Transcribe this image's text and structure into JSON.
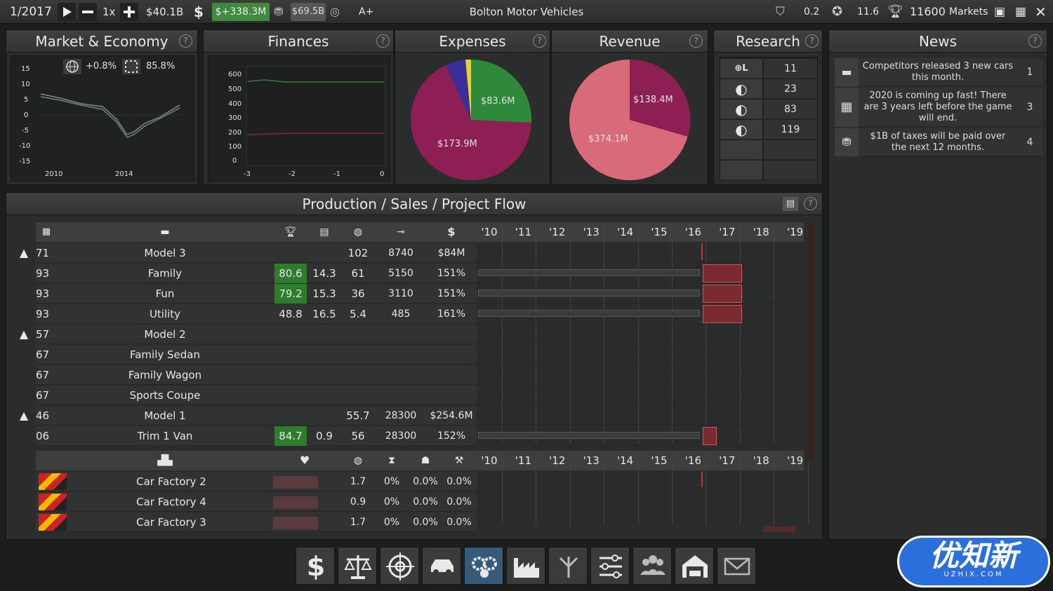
{
  "topbar": {
    "date": "1/2017",
    "speed": "1x",
    "cash": "$40.1B",
    "profit": "$+338.3M",
    "stock_value": "$69.5B",
    "rating": "A+",
    "company": "Bolton Motor Vehicles",
    "stat1": "0.2",
    "stat2": "11.6",
    "trophy": "11600",
    "markets": "Markets"
  },
  "panels": {
    "market": "Market & Economy",
    "finances": "Finances",
    "expenses": "Expenses",
    "revenue": "Revenue",
    "research": "Research",
    "news": "News",
    "flow": "Production / Sales / Project Flow"
  },
  "help": "?",
  "market": {
    "growth": "+0.8%",
    "share": "85.8%",
    "y_ticks": [
      "15",
      "10",
      "5",
      "0",
      "-5",
      "-10",
      "-15"
    ],
    "x_ticks": [
      "2010",
      "2014"
    ]
  },
  "finances": {
    "y_ticks": [
      "600",
      "500",
      "400",
      "300",
      "200",
      "100",
      "0"
    ],
    "x_ticks": [
      "-3",
      "-2",
      "-1",
      "0"
    ]
  },
  "expenses": {
    "labels": [
      "$83.6M",
      "$173.9M"
    ]
  },
  "revenue": {
    "labels": [
      "$138.4M",
      "$374.1M"
    ]
  },
  "research": {
    "rows": [
      {
        "icon": "⊕L",
        "value": "11"
      },
      {
        "icon": "◐",
        "value": "23"
      },
      {
        "icon": "◐",
        "value": "83"
      },
      {
        "icon": "◐",
        "value": "119"
      },
      {
        "icon": "",
        "value": ""
      },
      {
        "icon": "",
        "value": ""
      }
    ]
  },
  "news": [
    {
      "text": "Competitors released 3 new cars this month.",
      "count": "1"
    },
    {
      "text": "2020 is coming up fast! There are 3 years left before the game will end.",
      "count": "3"
    },
    {
      "text": "$1B of taxes will be paid over the next 12 months.",
      "count": "4"
    }
  ],
  "years": [
    "'10",
    "'11",
    "'12",
    "'13",
    "'14",
    "'15",
    "'16",
    "'17",
    "'18",
    "'19"
  ],
  "models": [
    {
      "arrow": "▲",
      "id": "71",
      "name": "Model 3",
      "rating": "",
      "price": "",
      "c3": "102",
      "c4": "8740",
      "c5": "$84M"
    },
    {
      "arrow": "",
      "id": "93",
      "name": "Family",
      "rating": "80.6",
      "price": "14.3",
      "c3": "61",
      "c4": "5150",
      "c5": "151%"
    },
    {
      "arrow": "",
      "id": "93",
      "name": "Fun",
      "rating": "79.2",
      "price": "15.3",
      "c3": "36",
      "c4": "3110",
      "c5": "151%"
    },
    {
      "arrow": "",
      "id": "93",
      "name": "Utility",
      "rating": "48.8",
      "price": "16.5",
      "c3": "5.4",
      "c4": "485",
      "c5": "161%"
    },
    {
      "arrow": "▲",
      "id": "57",
      "name": "Model 2",
      "rating": "",
      "price": "",
      "c3": "",
      "c4": "",
      "c5": ""
    },
    {
      "arrow": "",
      "id": "67",
      "name": "Family Sedan",
      "rating": "",
      "price": "",
      "c3": "",
      "c4": "",
      "c5": ""
    },
    {
      "arrow": "",
      "id": "67",
      "name": "Family Wagon",
      "rating": "",
      "price": "",
      "c3": "",
      "c4": "",
      "c5": ""
    },
    {
      "arrow": "",
      "id": "67",
      "name": "Sports Coupe",
      "rating": "",
      "price": "",
      "c3": "",
      "c4": "",
      "c5": ""
    },
    {
      "arrow": "▲",
      "id": "46",
      "name": "Model 1",
      "rating": "",
      "price": "",
      "c3": "55.7",
      "c4": "28300",
      "c5": "$254.6M"
    },
    {
      "arrow": "",
      "id": "06",
      "name": "Trim 1 Van",
      "rating": "84.7",
      "price": "0.9",
      "c3": "56",
      "c4": "28300",
      "c5": "152%"
    }
  ],
  "factories": [
    {
      "name": "Car Factory 2",
      "c1": "1.7",
      "c2": "0%",
      "c3": "0.0%",
      "c4": "0.0%"
    },
    {
      "name": "Car Factory 4",
      "c1": "0.9",
      "c2": "0%",
      "c3": "0.0%",
      "c4": "0.0%"
    },
    {
      "name": "Car Factory 3",
      "c1": "1.7",
      "c2": "0%",
      "c3": "0.0%",
      "c4": "0.0%"
    }
  ],
  "dock": [
    "dollar-icon",
    "scales-icon",
    "target-icon",
    "car-icon",
    "gears-icon",
    "factory-icon",
    "branch-icon",
    "sliders-icon",
    "people-icon",
    "garage-icon",
    "mail-icon"
  ],
  "watermark": {
    "text": "优知新",
    "sub": "UZHIX.COM"
  },
  "colors": {
    "green_cell": "#2d7d2d",
    "bar_red": "#7b2a30",
    "profit_bg": "#3f8a3f"
  }
}
